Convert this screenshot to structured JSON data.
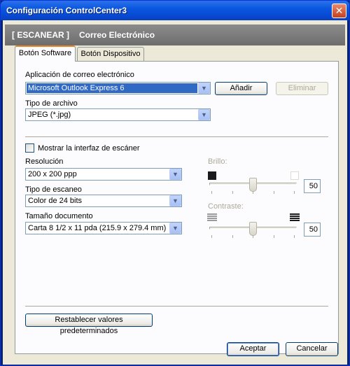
{
  "window": {
    "title": "Configuración ControlCenter3",
    "close_symbol": "✕"
  },
  "header": {
    "section": "[ ESCANEAR ]",
    "subtitle": "Correo Electrónico"
  },
  "tabs": [
    {
      "label": "Botón Software",
      "active": true
    },
    {
      "label": "Botón Dispositivo",
      "active": false
    }
  ],
  "email_app": {
    "label": "Aplicación de correo electrónico",
    "value": "Microsoft Outlook Express 6",
    "add_button": "Añadir",
    "remove_button": "Eliminar"
  },
  "file_type": {
    "label": "Tipo de archivo",
    "value": "JPEG (*.jpg)"
  },
  "show_scanner_ui": {
    "label": "Mostrar la interfaz de escáner",
    "checked": false
  },
  "resolution": {
    "label": "Resolución",
    "value": "200 x 200 ppp"
  },
  "scan_type": {
    "label": "Tipo de escaneo",
    "value": "Color de 24 bits"
  },
  "doc_size": {
    "label": "Tamaño documento",
    "value": "Carta 8 1/2 x 11 pda (215.9 x 279.4 mm)"
  },
  "brightness": {
    "label": "Brillo:",
    "value": "50",
    "level": 0.5
  },
  "contrast": {
    "label": "Contraste:",
    "value": "50",
    "level": 0.5
  },
  "reset_button": "Restablecer valores predeterminados",
  "footer": {
    "accept": "Aceptar",
    "cancel": "Cancelar"
  },
  "colors": {
    "titlebar": "#0a57e0",
    "selection": "#316ac5",
    "dialog_bg": "#ece9d8",
    "header_band": "#7a7a7a"
  },
  "icons": {
    "close": "close-icon",
    "dropdown": "chevron-down-icon",
    "brightness_low": "dark-square-icon",
    "brightness_high": "light-square-icon",
    "contrast_low": "low-contrast-icon",
    "contrast_high": "high-contrast-icon"
  }
}
